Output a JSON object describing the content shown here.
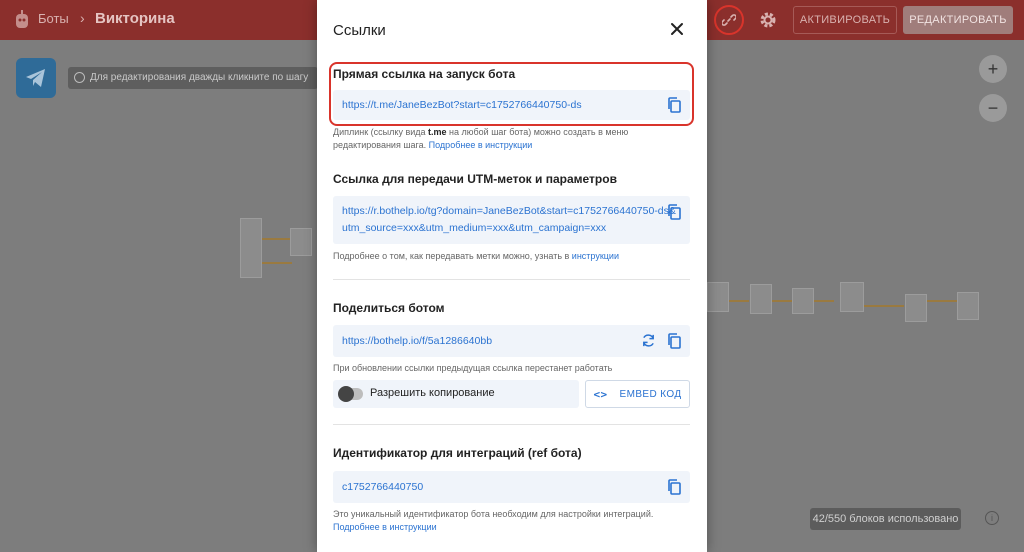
{
  "topbar": {
    "breadcrumb": "Боты",
    "bot_title": "Викторина",
    "activate_label": "АКТИВИРОВАТЬ",
    "edit_label": "РЕДАКТИРОВАТЬ"
  },
  "canvas": {
    "hint": "Для редактирования дважды кликните по шагу",
    "zoom_in": "+",
    "zoom_out": "−",
    "blocks_used": "42/550 блоков использовано",
    "info": "i"
  },
  "modal": {
    "title": "Ссылки",
    "direct": {
      "title": "Прямая ссылка на запуск бота",
      "url": "https://t.me/JaneBezBot?start=c1752766440750-ds",
      "note_pre": "Диплинк (ссылку вида ",
      "note_bold": "t.me",
      "note_mid": " на любой шаг бота) можно создать в меню редактирования шага. ",
      "note_link": "Подробнее в инструкции"
    },
    "utm": {
      "title": "Ссылка для передачи UTM-меток и параметров",
      "url_line1": "https://r.bothelp.io/tg?domain=JaneBezBot&start=c1752766440750-ds&",
      "url_line2": "utm_source=xxx&utm_medium=xxx&utm_campaign=xxx",
      "note_pre": "Подробнее о том, как передавать метки можно, узнать в ",
      "note_link": "инструкции"
    },
    "share": {
      "title": "Поделиться ботом",
      "url": "https://bothelp.io/f/5a1286640bb",
      "note": "При обновлении ссылки предыдущая ссылка перестанет работать",
      "toggle_label": "Разрешить копирование",
      "embed_label": "EMBED КОД"
    },
    "ref": {
      "title": "Идентификатор для интеграций (ref бота)",
      "value": "c1752766440750",
      "note": "Это уникальный идентификатор бота необходим для настройки интеграций.",
      "note_link": "Подробнее в инструкции"
    }
  },
  "colors": {
    "topbar": "#8b2f2c",
    "accent_blue": "#2b73d1",
    "highlight_red": "#d9342b",
    "field_bg": "#f0f4fa"
  }
}
